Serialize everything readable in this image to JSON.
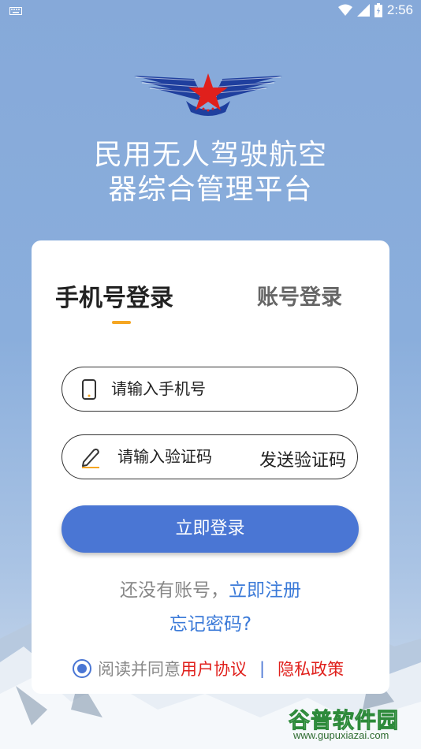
{
  "status_bar": {
    "time": "2:56"
  },
  "app": {
    "title_line1": "民用无人驾驶航空",
    "title_line2": "器综合管理平台"
  },
  "tabs": {
    "phone_login": "手机号登录",
    "account_login": "账号登录"
  },
  "phone_field": {
    "placeholder": "请输入手机号"
  },
  "code_field": {
    "placeholder": "请输入验证码",
    "send_code": "发送验证码"
  },
  "login_button": "立即登录",
  "register": {
    "prompt": "还没有账号，",
    "link": "立即注册"
  },
  "forgot_password": "忘记密码?",
  "agreement": {
    "prefix": "阅读并同意",
    "user_agreement": "用户协议",
    "separator": "|",
    "privacy_policy": "隐私政策",
    "checked": true
  },
  "watermark": {
    "main": "谷普软件园",
    "url": "www.gupuxiazai.com"
  },
  "colors": {
    "primary": "#4a76d4",
    "accent": "#f5a623",
    "link": "#3b7ad8",
    "agreement_link": "#e0201c"
  }
}
